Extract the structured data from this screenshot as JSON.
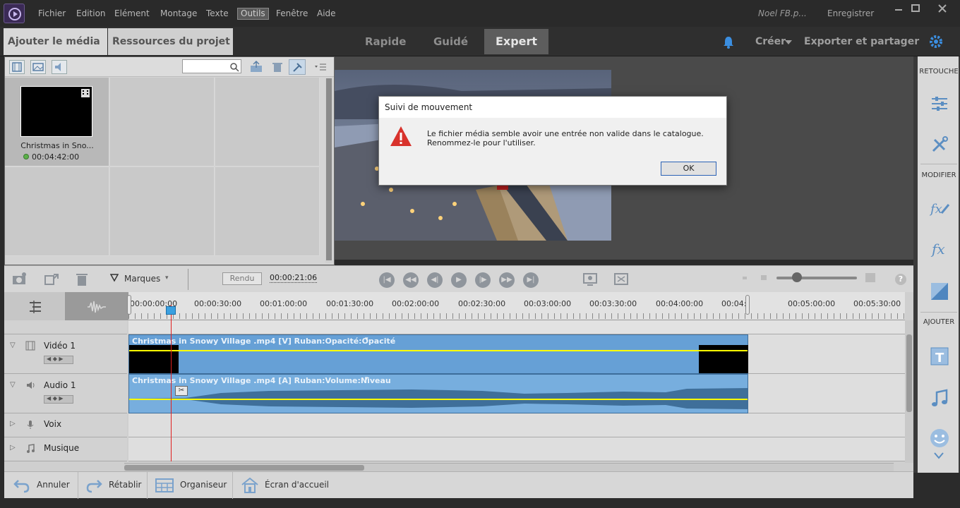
{
  "menubar": {
    "items": [
      "Fichier",
      "Edition",
      "Elément",
      "Montage",
      "Texte",
      "Outils",
      "Fenêtre",
      "Aide"
    ],
    "user": "Noel FB.p...",
    "save_label": "Enregistrer"
  },
  "modebar": {
    "add_media": "Ajouter le média",
    "project_assets": "Ressources du projet",
    "modes": [
      "Rapide",
      "Guidé",
      "Expert"
    ],
    "active_mode": "Expert",
    "create": "Créer",
    "export": "Exporter et partager"
  },
  "media": {
    "clip_name": "Christmas in Sno...",
    "clip_duration": "00:04:42:00"
  },
  "right_panel": {
    "sections": [
      "RETOUCHE",
      "MODIFIER",
      "AJOUTER"
    ]
  },
  "transport": {
    "markers_label": "Marques",
    "render_label": "Rendu",
    "timecode": "00:00:21:06"
  },
  "timeline": {
    "ruler_ticks": [
      "00:00:00:00",
      "00:00:30:00",
      "00:01:00:00",
      "00:01:30:00",
      "00:02:00:00",
      "00:02:30:00",
      "00:03:00:00",
      "00:03:30:00",
      "00:04:00:00",
      "00:04:",
      "00:05:00:00",
      "00:05:30:00"
    ],
    "tracks": [
      {
        "name": "Vidéo 1",
        "clip_label": "Christmas in Snowy Village .mp4 [V] Ruban:Opacité:Opacité"
      },
      {
        "name": "Audio 1",
        "clip_label": "Christmas in Snowy Village .mp4 [A] Ruban:Volume:Niveau"
      },
      {
        "name": "Voix"
      },
      {
        "name": "Musique"
      }
    ]
  },
  "bottombar": {
    "undo": "Annuler",
    "redo": "Rétablir",
    "organizer": "Organiseur",
    "home": "Écran d'accueil"
  },
  "dialog": {
    "title": "Suivi de mouvement",
    "message_line1": "Le fichier média semble avoir une entrée non valide dans le catalogue.",
    "message_line2": "Renommez-le pour l'utiliser.",
    "ok_label": "OK"
  }
}
